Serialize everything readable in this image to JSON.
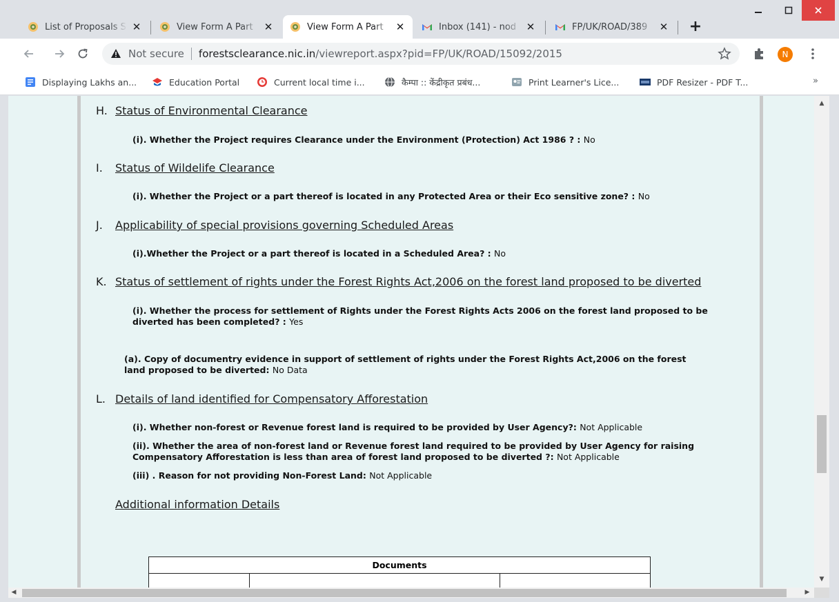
{
  "browser": {
    "tabs": [
      {
        "title": "List of Proposals S",
        "icon": "emblem-favicon-icon",
        "active": false
      },
      {
        "title": "View Form A Part",
        "icon": "emblem-favicon-icon",
        "active": false
      },
      {
        "title": "View Form A Part",
        "icon": "emblem-favicon-icon",
        "active": true
      },
      {
        "title": "Inbox (141) - nod",
        "icon": "gmail-icon",
        "active": false
      },
      {
        "title": "FP/UK/ROAD/389",
        "icon": "gmail-icon",
        "active": false
      }
    ],
    "close_glyph": "✕",
    "new_tab_glyph": "+",
    "address": {
      "security_label": "Not secure",
      "host": "forestsclearance.nic.in",
      "path": "/viewreport.aspx?pid=FP/UK/ROAD/15092/2015"
    },
    "profile_initial": "N",
    "bookmarks": [
      {
        "label": "Displaying Lakhs an...",
        "icon": "doc-blue-icon"
      },
      {
        "label": "Education Portal",
        "icon": "education-icon"
      },
      {
        "label": "Current local time i...",
        "icon": "clock-icon"
      },
      {
        "label": "कैम्पा :: केंद्रीकृत प्रबंध...",
        "icon": "globe-icon"
      },
      {
        "label": "Print Learner's Lice...",
        "icon": "license-icon"
      },
      {
        "label": "PDF Resizer - PDF T...",
        "icon": "pdf-icon"
      }
    ],
    "bookmarks_more": "»"
  },
  "report": {
    "sections": [
      {
        "letter": "H.",
        "title": "Status of Environmental Clearance",
        "questions": [
          {
            "q": "(i). Whether the Project requires Clearance under the Environment (Protection) Act 1986 ? : ",
            "a": "No"
          }
        ]
      },
      {
        "letter": "I.",
        "title": "Status of Wildelife Clearance",
        "questions": [
          {
            "q": "(i). Whether the Project or a part thereof is located in any Protected Area or their Eco sensitive zone? : ",
            "a": "No"
          }
        ]
      },
      {
        "letter": "J.",
        "title": "Applicability of special provisions governing Scheduled Areas",
        "questions": [
          {
            "q": "(i).Whether the Project or a part thereof is located in a Scheduled Area? : ",
            "a": "No"
          }
        ]
      },
      {
        "letter": "K.",
        "title": "Status of settlement of rights under the Forest Rights Act,2006 on the forest land proposed to be diverted",
        "questions": [
          {
            "q": "(i). Whether the process for settlement of Rights under the Forest Rights Acts 2006 on the forest land proposed to be diverted has been completed? : ",
            "a": "Yes"
          },
          {
            "q": "(a). Copy of documentry evidence in support of settlement of rights under the Forest Rights Act,2006 on the forest land proposed to be diverted: ",
            "a": "No Data"
          }
        ]
      },
      {
        "letter": "L.",
        "title": "Details of land identified for Compensatory Afforestation",
        "questions": [
          {
            "q": "(i). Whether non-forest or Revenue forest land is required to be provided by User Agency?: ",
            "a": "Not Applicable"
          },
          {
            "q": "(ii). Whether the area of non-forest land or Revenue forest land required to be provided by User Agency for raising Compensatory Afforestation is less than area of forest land proposed to be diverted ?: ",
            "a": "Not Applicable"
          },
          {
            "q": "(iii) . Reason for not providing Non-Forest Land: ",
            "a": "Not Applicable"
          }
        ]
      }
    ],
    "additional_info_link": "Additional information Details",
    "documents_table_header": "Documents"
  },
  "colors": {
    "page_bg": "#e8f4f4",
    "panel_border": "#c9c9c9",
    "chrome_bg": "#dee1e6",
    "window_close": "#e04343",
    "avatar": "#f57c00"
  }
}
